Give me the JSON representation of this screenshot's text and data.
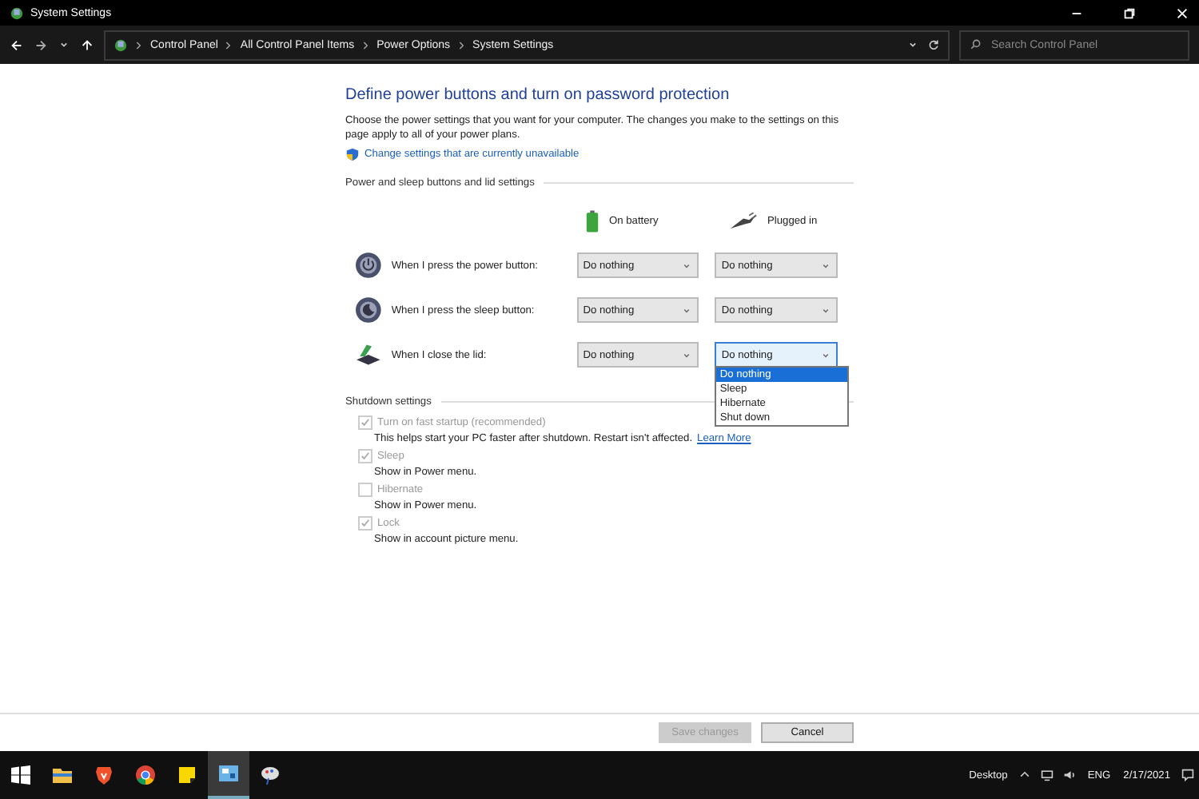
{
  "window": {
    "title": "System Settings"
  },
  "address_bar": {
    "breadcrumbs": [
      "Control Panel",
      "All Control Panel Items",
      "Power Options",
      "System Settings"
    ],
    "search": {
      "placeholder": "Search Control Panel"
    }
  },
  "page": {
    "heading": "Define power buttons and turn on password protection",
    "description": "Choose the power settings that you want for your computer. The changes you make to the settings on this page apply to all of your power plans.",
    "admin_link": "Change settings that are currently unavailable",
    "power_section": {
      "title": "Power and sleep buttons and lid settings",
      "columns": [
        {
          "label": "On battery",
          "kind": "battery"
        },
        {
          "label": "Plugged in",
          "kind": "plug"
        }
      ],
      "rows": [
        {
          "kind": "power",
          "label": "When I press the power button:",
          "values": [
            {
              "value": "Do nothing",
              "open": false
            },
            {
              "value": "Do nothing",
              "open": false
            }
          ]
        },
        {
          "kind": "sleep",
          "label": "When I press the sleep button:",
          "values": [
            {
              "value": "Do nothing",
              "open": false
            },
            {
              "value": "Do nothing",
              "open": false
            }
          ]
        },
        {
          "kind": "lid",
          "label": "When I close the lid:",
          "values": [
            {
              "value": "Do nothing",
              "open": false
            },
            {
              "value": "Do nothing",
              "open": true
            }
          ]
        }
      ],
      "dropdown_options": [
        {
          "label": "Do nothing",
          "selected": true
        },
        {
          "label": "Sleep",
          "selected": false
        },
        {
          "label": "Hibernate",
          "selected": false
        },
        {
          "label": "Shut down",
          "selected": false
        }
      ]
    },
    "shutdown_section": {
      "title": "Shutdown settings",
      "options": [
        {
          "label": "Turn on fast startup (recommended)",
          "checked": true,
          "disabled": true,
          "description": "This helps start your PC faster after shutdown. Restart isn't affected.",
          "link": "Learn More"
        },
        {
          "label": "Sleep",
          "checked": true,
          "disabled": true,
          "description": "Show in Power menu."
        },
        {
          "label": "Hibernate",
          "checked": false,
          "disabled": true,
          "description": "Show in Power menu."
        },
        {
          "label": "Lock",
          "checked": true,
          "disabled": true,
          "description": "Show in account picture menu."
        }
      ]
    }
  },
  "footer": {
    "buttons": [
      {
        "label": "Save changes",
        "disabled": true
      },
      {
        "label": "Cancel",
        "disabled": false
      }
    ]
  },
  "taskbar": {
    "apps": [
      {
        "kind": "start",
        "active": false
      },
      {
        "kind": "folder",
        "active": false
      },
      {
        "kind": "shield",
        "active": false
      },
      {
        "kind": "chrome",
        "active": false
      },
      {
        "kind": "note",
        "active": false
      },
      {
        "kind": "panel",
        "active": true
      },
      {
        "kind": "paint",
        "active": false
      }
    ],
    "desktop_label": "Desktop",
    "language": "ENG",
    "date": "2/17/2021"
  }
}
